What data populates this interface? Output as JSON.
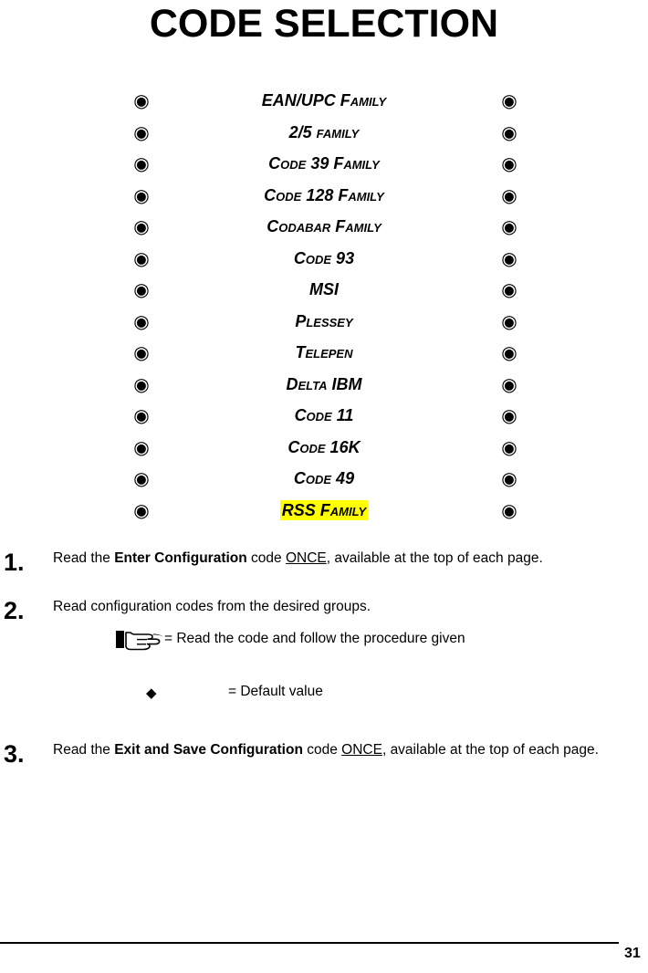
{
  "document": {
    "title": "CODE SELECTION",
    "page_number": "31"
  },
  "code_list": {
    "bullet_icon": "fisheye-bullet",
    "items": [
      {
        "label": "EAN/UPC Family",
        "highlighted": false
      },
      {
        "label": "2/5 family",
        "highlighted": false
      },
      {
        "label": "Code 39 Family",
        "highlighted": false
      },
      {
        "label": "Code 128 Family",
        "highlighted": false
      },
      {
        "label": "Codabar Family",
        "highlighted": false
      },
      {
        "label": "Code 93",
        "highlighted": false
      },
      {
        "label": "MSI",
        "highlighted": false
      },
      {
        "label": "Plessey",
        "highlighted": false
      },
      {
        "label": "Telepen",
        "highlighted": false
      },
      {
        "label": "Delta IBM",
        "highlighted": false
      },
      {
        "label": "Code 11",
        "highlighted": false
      },
      {
        "label": "Code 16K",
        "highlighted": false
      },
      {
        "label": "Code 49",
        "highlighted": false
      },
      {
        "label": "RSS Family",
        "highlighted": true
      }
    ],
    "highlight_color": "#FFFF00"
  },
  "steps": [
    {
      "number": "1.",
      "parts": [
        {
          "text": "Read the ",
          "style": "normal"
        },
        {
          "text": "Enter Configuration",
          "style": "bold"
        },
        {
          "text": " code ",
          "style": "normal"
        },
        {
          "text": "ONCE",
          "style": "underline"
        },
        {
          "text": ", available at the top of each page.",
          "style": "normal"
        }
      ]
    },
    {
      "number": "2.",
      "parts": [
        {
          "text": "Read configuration codes from the desired groups.",
          "style": "normal"
        }
      ]
    },
    {
      "number": "3.",
      "parts": [
        {
          "text": "Read the ",
          "style": "normal"
        },
        {
          "text": "Exit and Save Configuration",
          "style": "bold"
        },
        {
          "text": " code ",
          "style": "normal"
        },
        {
          "text": "ONCE",
          "style": "underline"
        },
        {
          "text": ", available at the top of each page.",
          "style": "normal"
        }
      ]
    }
  ],
  "legend": [
    {
      "icon": "pointing-hand-icon",
      "text": "= Read the code and follow the procedure given"
    },
    {
      "icon": "black-diamond-icon",
      "glyph": "◆",
      "text": "= Default value"
    }
  ]
}
